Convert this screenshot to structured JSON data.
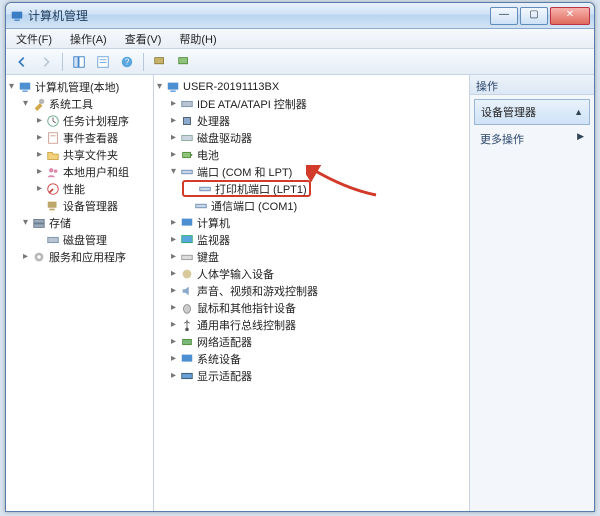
{
  "window": {
    "title": "计算机管理"
  },
  "menu": {
    "file": "文件(F)",
    "action": "操作(A)",
    "view": "查看(V)",
    "help": "帮助(H)"
  },
  "left": {
    "root": "计算机管理(本地)",
    "tools": "系统工具",
    "task": "任务计划程序",
    "event": "事件查看器",
    "shared": "共享文件夹",
    "users": "本地用户和组",
    "perf": "性能",
    "devmgr": "设备管理器",
    "storage": "存储",
    "diskmgr": "磁盘管理",
    "services": "服务和应用程序"
  },
  "mid": {
    "host": "USER-20191113BX",
    "ide": "IDE ATA/ATAPI 控制器",
    "cpu": "处理器",
    "cdrom": "磁盘驱动器",
    "battery": "电池",
    "ports": "端口 (COM 和 LPT)",
    "lpt1": "打印机端口 (LPT1)",
    "com1": "通信端口 (COM1)",
    "computer": "计算机",
    "monitor": "监视器",
    "keyboard": "键盘",
    "hid": "人体学输入设备",
    "media": "声音、视频和游戏控制器",
    "mouse": "鼠标和其他指针设备",
    "usb": "通用串行总线控制器",
    "network": "网络适配器",
    "sysdev": "系统设备",
    "display": "显示适配器"
  },
  "right": {
    "header": "操作",
    "selected": "设备管理器",
    "more": "更多操作"
  }
}
